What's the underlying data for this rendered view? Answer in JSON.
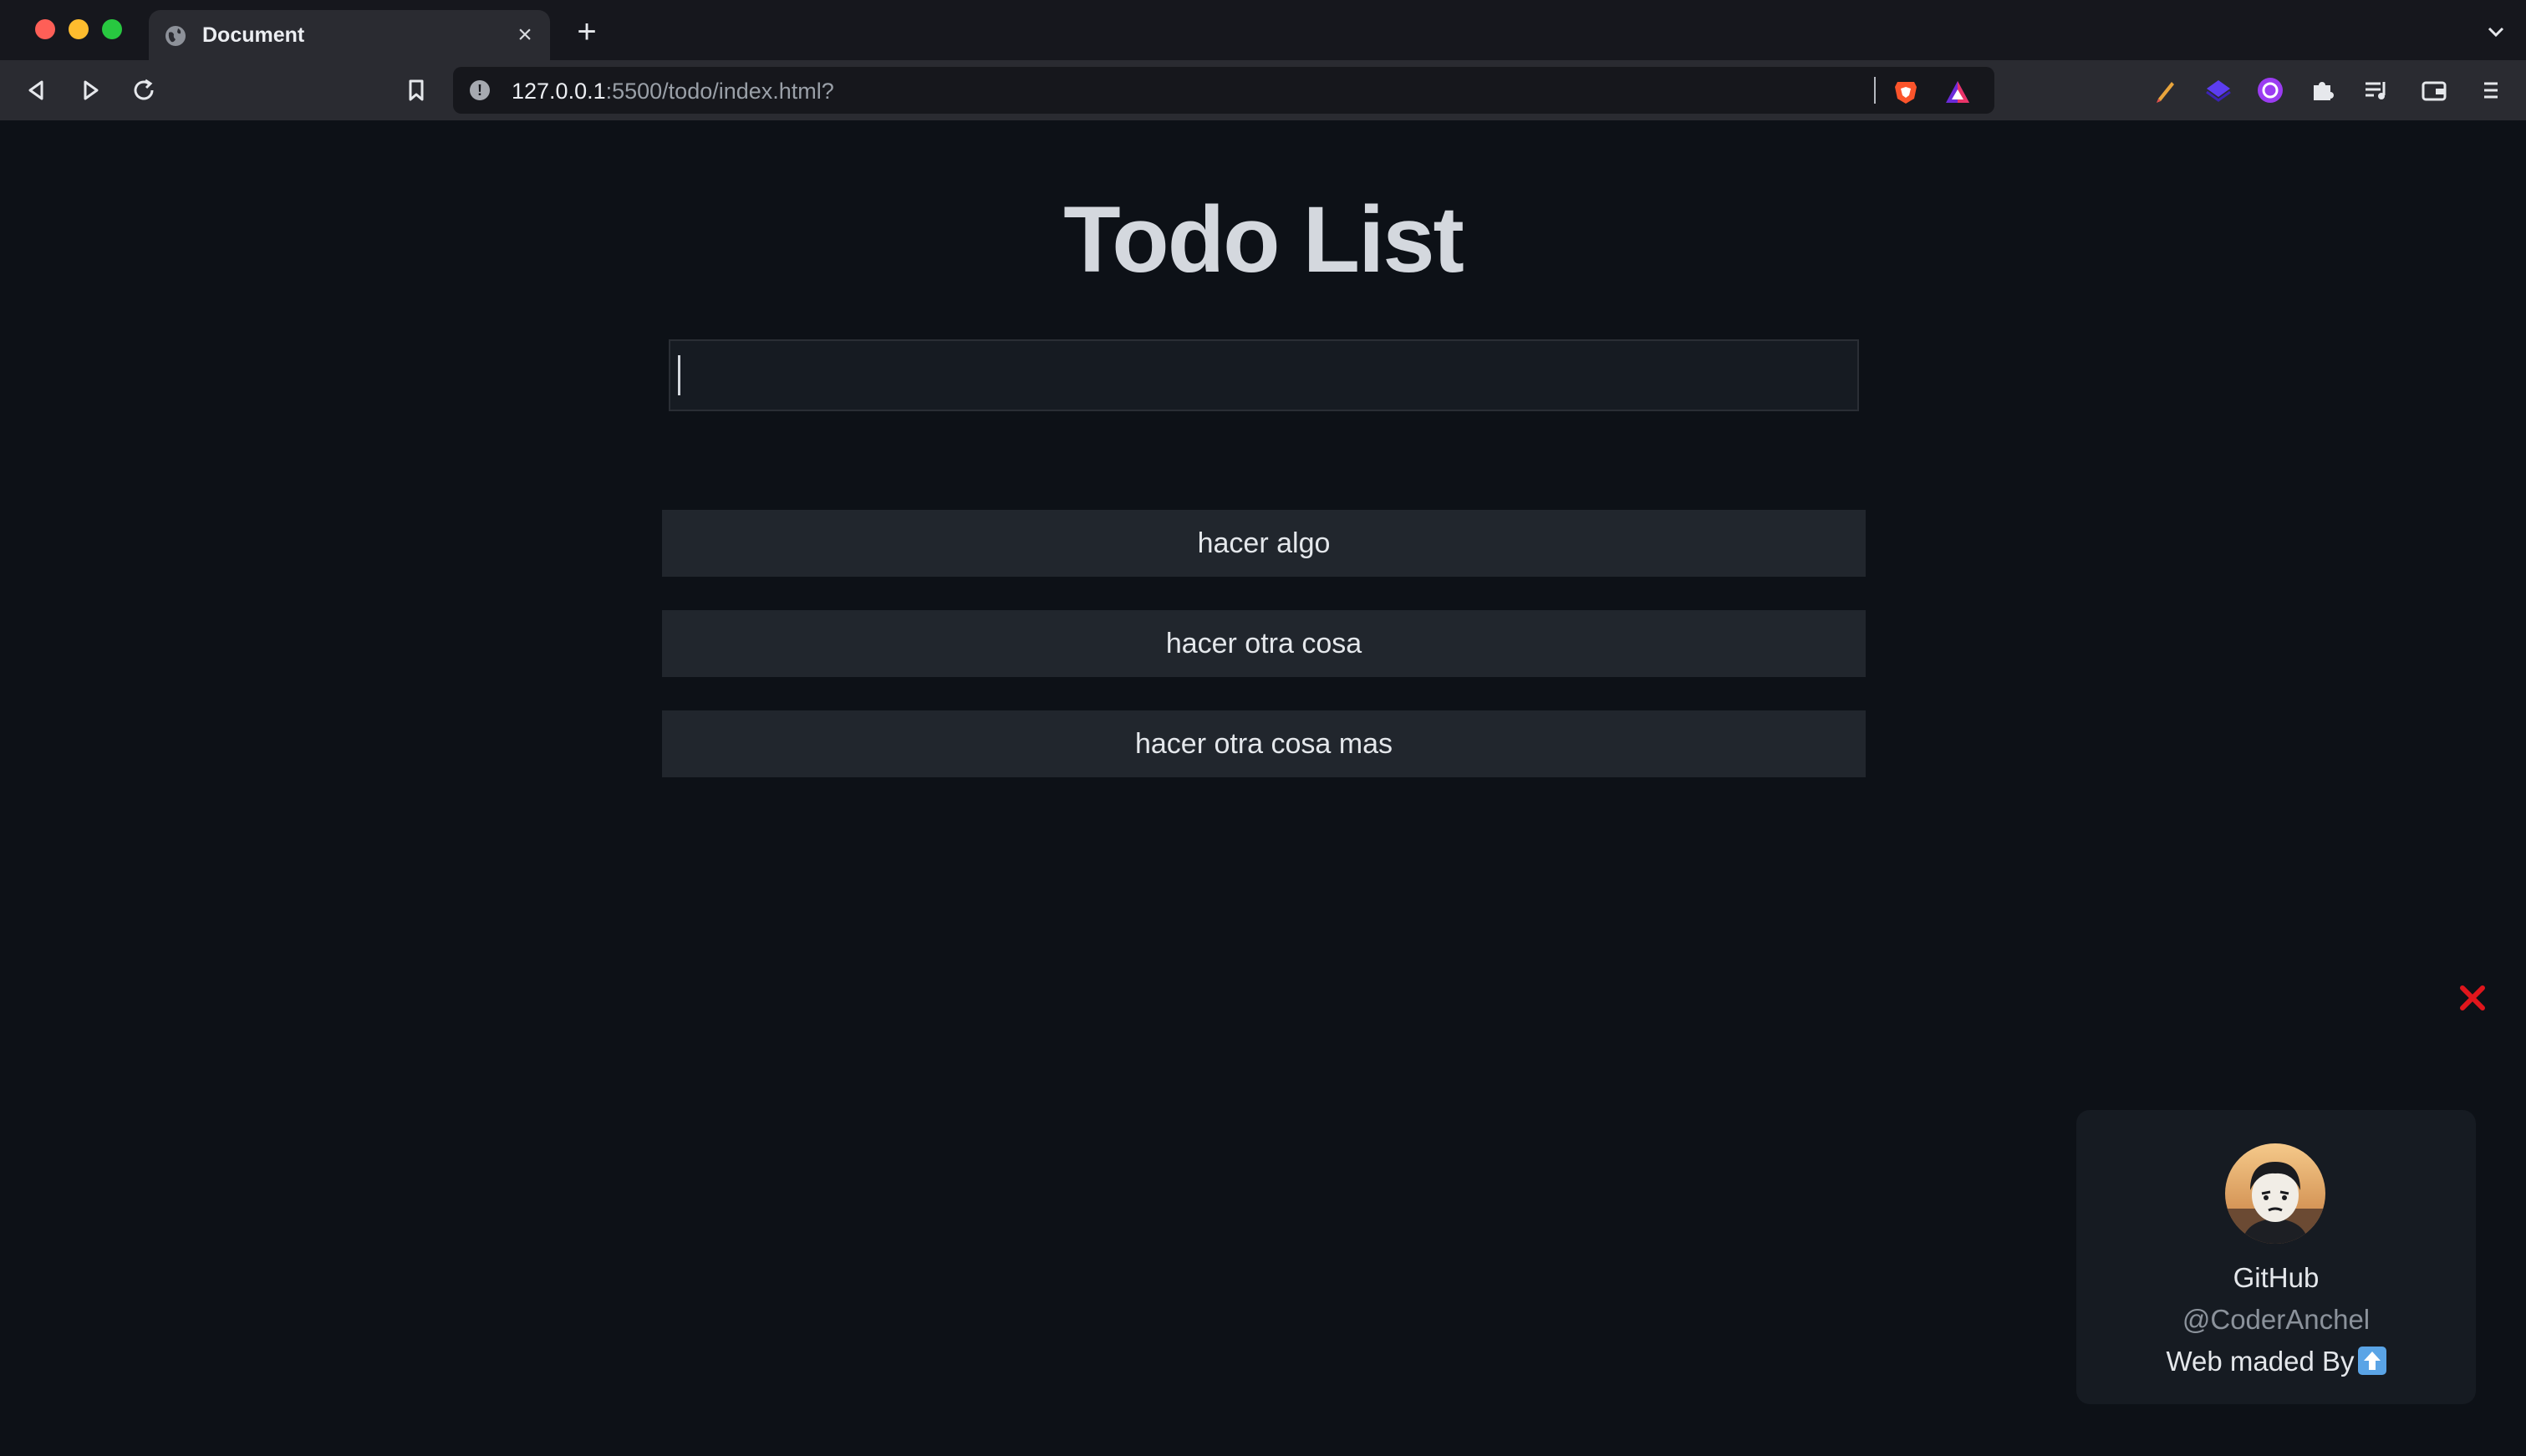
{
  "browser": {
    "tab": {
      "title": "Document"
    },
    "url": {
      "host": "127.0.0.1",
      "rest": ":5500/todo/index.html?"
    }
  },
  "page": {
    "title": "Todo List",
    "input": {
      "value": "",
      "placeholder": ""
    },
    "todos": [
      {
        "label": "hacer algo"
      },
      {
        "label": "hacer otra cosa"
      },
      {
        "label": "hacer otra cosa mas"
      }
    ]
  },
  "credit": {
    "title": "GitHub",
    "handle": "@CoderAnchel",
    "made_by": "Web maded By"
  },
  "colors": {
    "page_bg": "#0d1117",
    "item_bg": "#21262d",
    "close_red": "#e0161c"
  }
}
